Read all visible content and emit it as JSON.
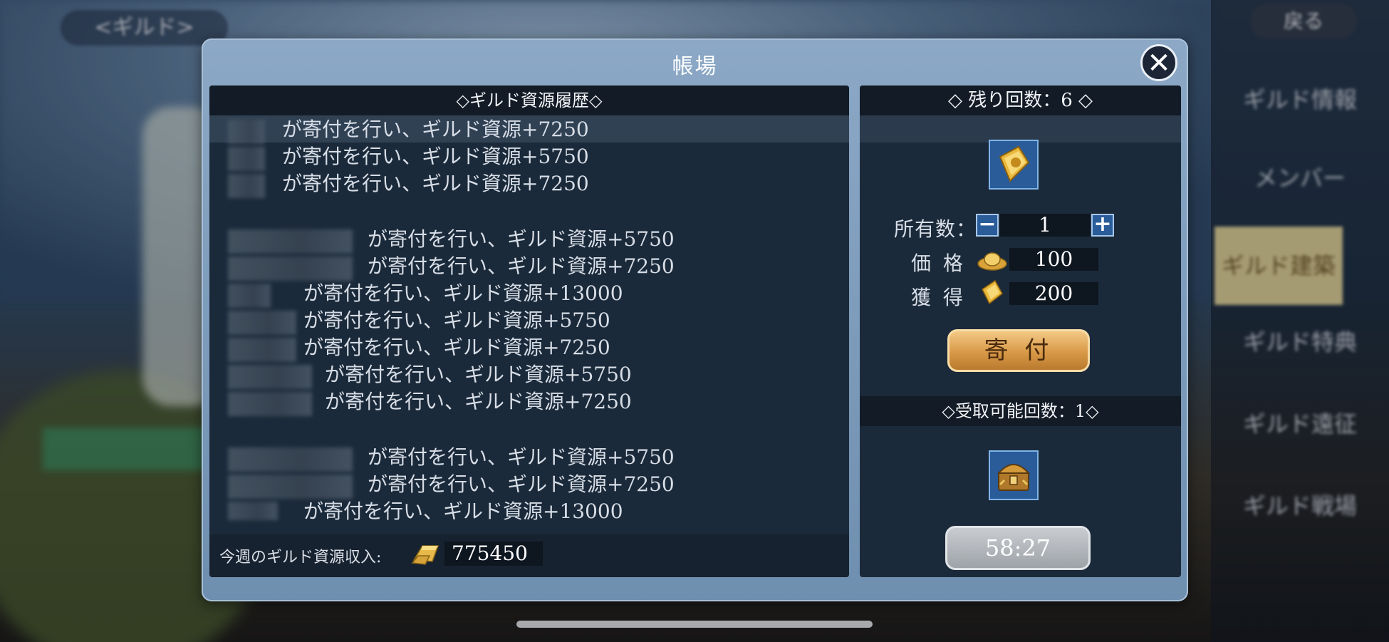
{
  "background": {
    "guild_pill": "<ギルド>",
    "back_button": "戻る",
    "side_menu": [
      "ギルド情報",
      "メンバー",
      "ギルド建築",
      "ギルド特典",
      "ギルド遠征",
      "ギルド戦場"
    ]
  },
  "dialog": {
    "title": "帳場",
    "close_icon": "close-icon"
  },
  "history_panel": {
    "header": "◇ギルド資源履歴◇",
    "rows": [
      "が寄付を行い、ギルド資源+7250",
      "が寄付を行い、ギルド資源+5750",
      "が寄付を行い、ギルド資源+7250",
      "が寄付を行い、ギルド資源+5750",
      "が寄付を行い、ギルド資源+7250",
      "が寄付を行い、ギルド資源+13000",
      "が寄付を行い、ギルド資源+5750",
      "が寄付を行い、ギルド資源+7250",
      "が寄付を行い、ギルド資源+5750",
      "が寄付を行い、ギルド資源+7250",
      "が寄付を行い、ギルド資源+5750",
      "が寄付を行い、ギルド資源+7250",
      "が寄付を行い、ギルド資源+13000"
    ],
    "income_label": "今週のギルド資源収入:",
    "income_value": "775450"
  },
  "donate_panel": {
    "remaining_header": "◇ 残り回数：6 ◇",
    "owned_label": "所有数：",
    "owned_value": "1",
    "price_label": "価 格",
    "price_value": "100",
    "gain_label": "獲 得",
    "gain_value": "200",
    "donate_button": "寄 付",
    "claim_header": "◇受取可能回数：1◇",
    "timer": "58:27"
  },
  "colors": {
    "dialog_frame": "#7f9dbd",
    "panel_bg": "#1b2a3a",
    "header_bg": "#121b26",
    "donate_gold": "#d89947"
  }
}
